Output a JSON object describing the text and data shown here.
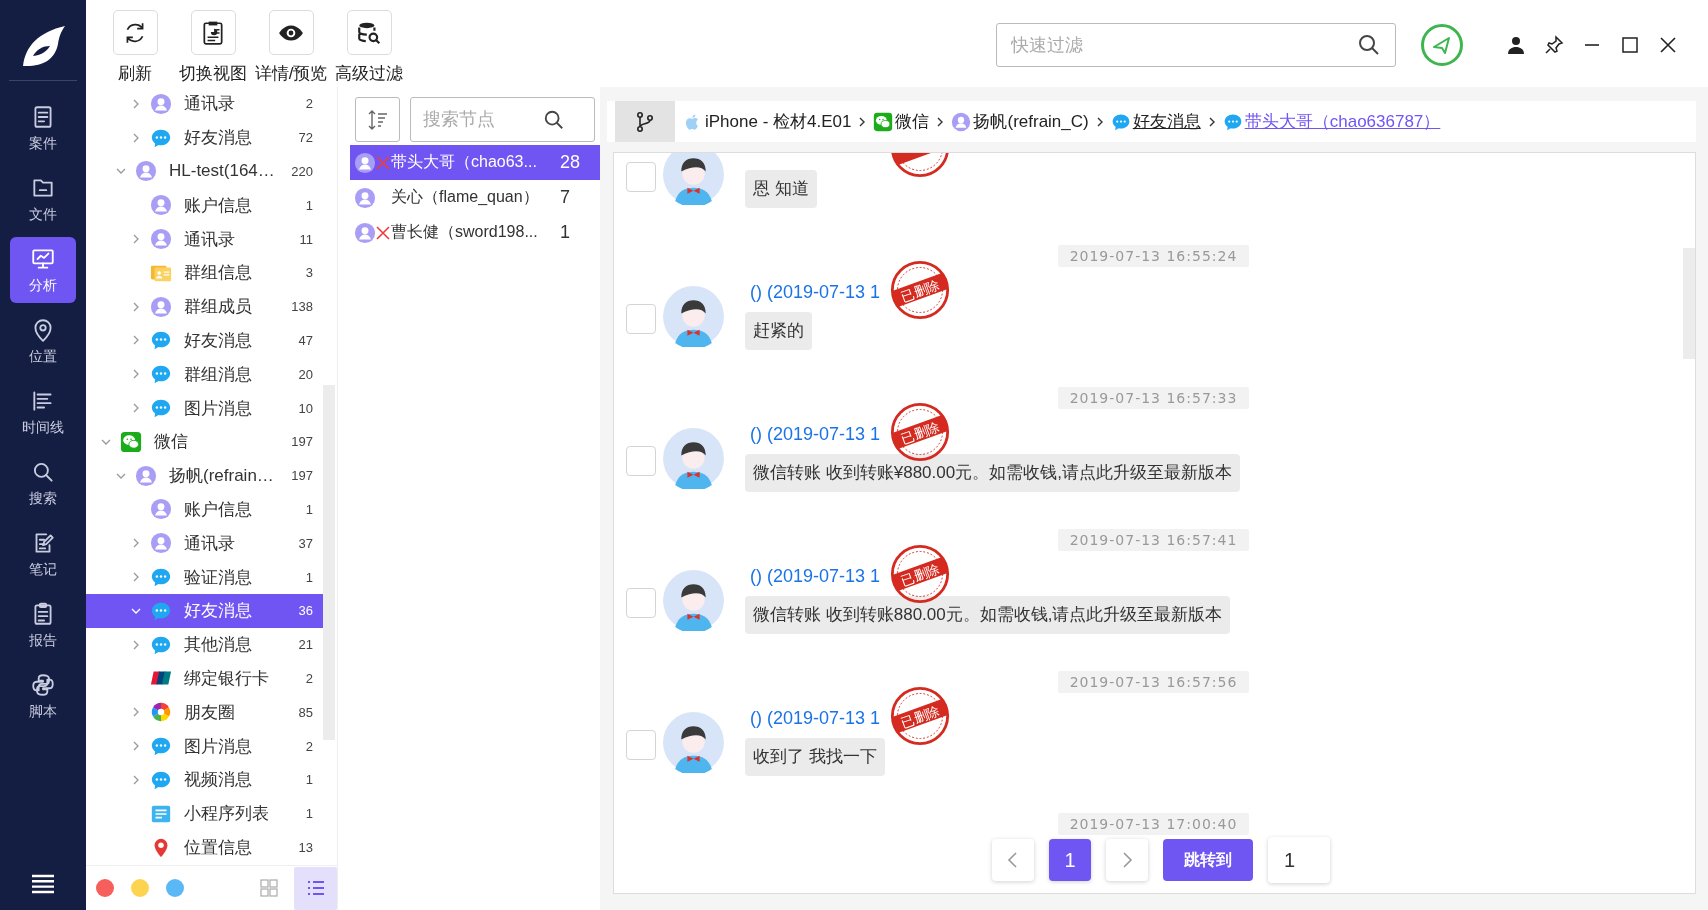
{
  "nav": {
    "items": [
      {
        "label": "案件",
        "selected": false
      },
      {
        "label": "文件",
        "selected": false
      },
      {
        "label": "分析",
        "selected": true
      },
      {
        "label": "位置",
        "selected": false
      },
      {
        "label": "时间线",
        "selected": false
      },
      {
        "label": "搜索",
        "selected": false
      },
      {
        "label": "笔记",
        "selected": false
      },
      {
        "label": "报告",
        "selected": false
      },
      {
        "label": "脚本",
        "selected": false
      }
    ]
  },
  "toolbar": {
    "buttons": [
      {
        "label": "刷新"
      },
      {
        "label": "切换视图"
      },
      {
        "label": "详情/预览"
      },
      {
        "label": "高级过滤"
      }
    ],
    "filter": {
      "placeholder": "快速过滤"
    }
  },
  "tree": {
    "nodes": [
      {
        "children": [
          {
            "children": [
              {
                "label": "通讯录",
                "count": "2",
                "kind": "contact",
                "expanded": false,
                "selected": false
              },
              {
                "label": "好友消息",
                "count": "72",
                "kind": "chat",
                "expanded": false,
                "selected": false
              }
            ]
          },
          {
            "label": "HL-test(164…",
            "count": "220",
            "kind": "contact",
            "expanded": true,
            "selected": false,
            "children": [
              {
                "label": "账户信息",
                "count": "1",
                "kind": "contact",
                "selected": false
              },
              {
                "label": "通讯录",
                "count": "11",
                "kind": "contact",
                "expanded": false,
                "selected": false
              },
              {
                "label": "群组信息",
                "count": "3",
                "kind": "group",
                "selected": false
              },
              {
                "label": "群组成员",
                "count": "138",
                "kind": "contact",
                "expanded": false,
                "selected": false
              },
              {
                "label": "好友消息",
                "count": "47",
                "kind": "chat",
                "expanded": false,
                "selected": false
              },
              {
                "label": "群组消息",
                "count": "20",
                "kind": "chat",
                "expanded": false,
                "selected": false
              },
              {
                "label": "图片消息",
                "count": "10",
                "kind": "chat",
                "expanded": false,
                "selected": false
              }
            ]
          }
        ]
      },
      {
        "label": "微信",
        "count": "197",
        "kind": "wechat",
        "expanded": true,
        "selected": false,
        "children": [
          {
            "label": "扬帆(refrain…",
            "count": "197",
            "kind": "contact",
            "expanded": true,
            "selected": false,
            "children": [
              {
                "label": "账户信息",
                "count": "1",
                "kind": "contact",
                "selected": false
              },
              {
                "label": "通讯录",
                "count": "37",
                "kind": "contact",
                "expanded": false,
                "selected": false
              },
              {
                "label": "验证消息",
                "count": "1",
                "kind": "chat",
                "expanded": false,
                "selected": false
              },
              {
                "label": "好友消息",
                "count": "36",
                "kind": "chat",
                "expanded": true,
                "selected": true
              },
              {
                "label": "其他消息",
                "count": "21",
                "kind": "chat",
                "expanded": false,
                "selected": false
              },
              {
                "label": "绑定银行卡",
                "count": "2",
                "kind": "bank",
                "selected": false
              },
              {
                "label": "朋友圈",
                "count": "85",
                "kind": "moments",
                "expanded": false,
                "selected": false
              },
              {
                "label": "图片消息",
                "count": "2",
                "kind": "chat",
                "expanded": false,
                "selected": false
              },
              {
                "label": "视频消息",
                "count": "1",
                "kind": "chat",
                "expanded": false,
                "selected": false
              },
              {
                "label": "小程序列表",
                "count": "1",
                "kind": "applet",
                "selected": false
              },
              {
                "label": "位置信息",
                "count": "13",
                "kind": "location",
                "selected": false
              }
            ]
          }
        ]
      }
    ],
    "color_dots": [
      {
        "color": "#f65f5b"
      },
      {
        "color": "#fdd44f"
      },
      {
        "color": "#5bb8f7"
      }
    ],
    "views": [
      {
        "selected": false
      },
      {
        "selected": true
      }
    ]
  },
  "node_list": {
    "search_placeholder": "搜索节点",
    "items": [
      {
        "name": "带头大哥（chao63...",
        "count": "28",
        "deleted": true,
        "selected": true
      },
      {
        "name": "关心（flame_quan）",
        "count": "7",
        "deleted": false,
        "selected": false
      },
      {
        "name": "曹长健（sword198...",
        "count": "1",
        "deleted": true,
        "selected": false
      }
    ]
  },
  "breadcrumb": [
    {
      "label": "iPhone - 检材4.E01",
      "kind": "apple",
      "link": false,
      "selected": false
    },
    {
      "label": "微信",
      "kind": "wechat",
      "link": false,
      "selected": false
    },
    {
      "label": "扬帆(refrain_C)",
      "kind": "contact",
      "link": false,
      "selected": false
    },
    {
      "label": "好友消息",
      "kind": "chat",
      "link": true,
      "selected": false
    },
    {
      "label": "带头大哥（chao636787）",
      "kind": "chat",
      "link": true,
      "selected": true
    }
  ],
  "chat": {
    "items": [
      {
        "kind": "message",
        "text": "恩 知道",
        "checked": false,
        "deleted": true
      },
      {
        "kind": "time",
        "text": "2019-07-13 16:55:24"
      },
      {
        "kind": "message",
        "sender": "() (2019-07-13 1",
        "text": "赶紧的",
        "checked": false,
        "deleted": true,
        "stamp": "已删除"
      },
      {
        "kind": "time",
        "text": "2019-07-13 16:57:33"
      },
      {
        "kind": "message",
        "sender": "() (2019-07-13 1",
        "text": "微信转账 收到转账¥880.00元。如需收钱,请点此升级至最新版本",
        "checked": false,
        "deleted": true,
        "stamp": "已删除"
      },
      {
        "kind": "time",
        "text": "2019-07-13 16:57:41"
      },
      {
        "kind": "message",
        "sender": "() (2019-07-13 1",
        "text": "微信转账 收到转账880.00元。如需收钱,请点此升级至最新版本",
        "checked": false,
        "deleted": true,
        "stamp": "已删除"
      },
      {
        "kind": "time",
        "text": "2019-07-13 16:57:56"
      },
      {
        "kind": "message",
        "sender": "() (2019-07-13 1",
        "text": "收到了 我找一下",
        "checked": false,
        "deleted": true,
        "stamp": "已删除"
      },
      {
        "kind": "time",
        "text": "2019-07-13 17:00:40"
      }
    ]
  },
  "pagination": {
    "pages": [
      {
        "label": "1",
        "selected": true
      }
    ],
    "jump_button": "跳转到",
    "jump_value": "1"
  }
}
